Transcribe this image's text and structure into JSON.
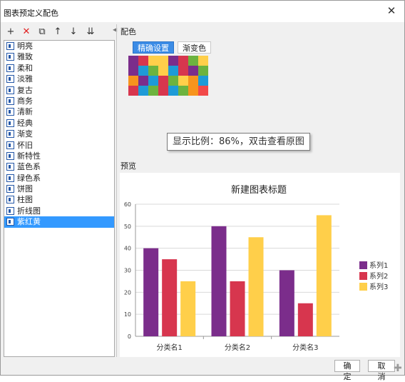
{
  "dialog": {
    "title": "图表预定义配色"
  },
  "toolbar": [
    {
      "name": "add-icon",
      "glyph": "+"
    },
    {
      "name": "delete-icon",
      "glyph": "✕",
      "color": "#e02020"
    },
    {
      "name": "copy-icon",
      "glyph": "⧉"
    },
    {
      "name": "move-up-icon",
      "glyph": "↑"
    },
    {
      "name": "move-down-icon",
      "glyph": "↓"
    },
    {
      "name": "move-bottom-icon",
      "glyph": "⇊"
    }
  ],
  "schemes": {
    "items": [
      "明亮",
      "雅致",
      "柔和",
      "淡雅",
      "复古",
      "商务",
      "清新",
      "经典",
      "渐变",
      "怀旧",
      "新特性",
      "蓝色系",
      "绿色系",
      "饼图",
      "柱图",
      "折线图",
      "紫红黄"
    ],
    "selected_index": 16
  },
  "color_section": {
    "label": "配色",
    "tabs": [
      {
        "label": "精确设置",
        "active": true
      },
      {
        "label": "渐变色",
        "active": false
      }
    ],
    "swatches": [
      "#7b2d8b",
      "#d7364e",
      "#ffcf4a",
      "#ffcf4a",
      "#7b2d8b",
      "#d7364e",
      "#6db33f",
      "#ffcf4a",
      "#7b2d8b",
      "#1e9bd7",
      "#6db33f",
      "#ffcf4a",
      "#1e9bd7",
      "#d7364e",
      "#7b2d8b",
      "#6db33f",
      "#f7941d",
      "#7b2d8b",
      "#1e9bd7",
      "#d7364e",
      "#6db33f",
      "#ffcf4a",
      "#f7941d",
      "#1e9bd7",
      "#d7364e",
      "#1e9bd7",
      "#6db33f",
      "#d7364e",
      "#1e9bd7",
      "#6db33f",
      "#f7941d",
      "#f24949"
    ]
  },
  "zoom_tip": "显示比例：86%，双击查看原图",
  "preview_section": {
    "label": "预览"
  },
  "chart_data": {
    "type": "bar",
    "title": "新建图表标题",
    "categories": [
      "分类名1",
      "分类名2",
      "分类名3"
    ],
    "series": [
      {
        "name": "系列1",
        "values": [
          40,
          50,
          30
        ],
        "color": "#7b2d8b"
      },
      {
        "name": "系列2",
        "values": [
          35,
          25,
          15
        ],
        "color": "#d7364e"
      },
      {
        "name": "系列3",
        "values": [
          25,
          45,
          55
        ],
        "color": "#ffcf4a"
      }
    ],
    "ylim": [
      0,
      60
    ],
    "yticks": [
      0,
      10,
      20,
      30,
      40,
      50,
      60
    ],
    "grid": true,
    "legend": "right"
  },
  "footer": {
    "ok_label": "确定",
    "cancel_label": "取消"
  }
}
